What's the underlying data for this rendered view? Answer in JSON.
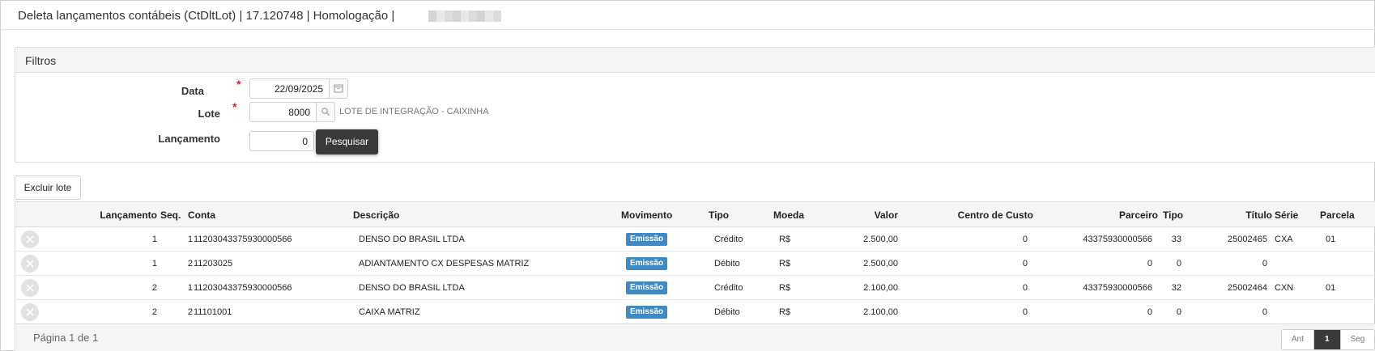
{
  "app": {
    "title": "Deleta lançamentos contábeis (CtDltLot) | 17.120748 | Homologação | "
  },
  "filters": {
    "section_title": "Filtros",
    "required_mark": "*",
    "data_label": "Data",
    "data_value": "22/09/2025",
    "lote_label": "Lote",
    "lote_value": "8000",
    "lote_description": "LOTE DE INTEGRAÇÃO - CAIXINHA",
    "lancamento_label": "Lançamento",
    "lancamento_value": "0",
    "search_label": "Pesquisar"
  },
  "actions": {
    "excluir_lote": "Excluir lote"
  },
  "table": {
    "headers": {
      "lancamento": "Lançamento",
      "seq": "Seq.",
      "conta": "Conta",
      "descricao": "Descrição",
      "movimento": "Movimento",
      "tipo": "Tipo",
      "moeda": "Moeda",
      "valor": "Valor",
      "centro_custo": "Centro de Custo",
      "parceiro": "Parceiro",
      "tipo2": "Tipo",
      "titulo": "Título",
      "serie": "Série",
      "parcela": "Parcela"
    },
    "rows": [
      {
        "lancamento": "1",
        "seq": "1",
        "conta": "11203043375930000566",
        "descricao": "DENSO DO BRASIL LTDA",
        "movimento": "Emissão",
        "tipo": "Crédito",
        "moeda": "R$",
        "valor": "2.500,00",
        "centro_custo": "0",
        "parceiro": "43375930000566",
        "tipo2": "33",
        "titulo": "25002465",
        "serie": "CXA",
        "parcela": "01"
      },
      {
        "lancamento": "1",
        "seq": "2",
        "conta": "11203025",
        "descricao": "ADIANTAMENTO CX DESPESAS MATRIZ",
        "movimento": "Emissão",
        "tipo": "Débito",
        "moeda": "R$",
        "valor": "2.500,00",
        "centro_custo": "0",
        "parceiro": "0",
        "tipo2": "0",
        "titulo": "0",
        "serie": "",
        "parcela": ""
      },
      {
        "lancamento": "2",
        "seq": "1",
        "conta": "11203043375930000566",
        "descricao": "DENSO DO BRASIL LTDA",
        "movimento": "Emissão",
        "tipo": "Crédito",
        "moeda": "R$",
        "valor": "2.100,00",
        "centro_custo": "0",
        "parceiro": "43375930000566",
        "tipo2": "32",
        "titulo": "25002464",
        "serie": "CXN",
        "parcela": "01"
      },
      {
        "lancamento": "2",
        "seq": "2",
        "conta": "11101001",
        "descricao": "CAIXA MATRIZ",
        "movimento": "Emissão",
        "tipo": "Débito",
        "moeda": "R$",
        "valor": "2.100,00",
        "centro_custo": "0",
        "parceiro": "0",
        "tipo2": "0",
        "titulo": "0",
        "serie": "",
        "parcela": ""
      }
    ]
  },
  "pagination": {
    "info": "Página 1 de 1",
    "prev": "Ant",
    "current": "1",
    "next": "Seg"
  },
  "colors": {
    "badge": "#3d8ac4",
    "required": "#d9232d",
    "tooltip_bg": "#3a3a3a"
  }
}
